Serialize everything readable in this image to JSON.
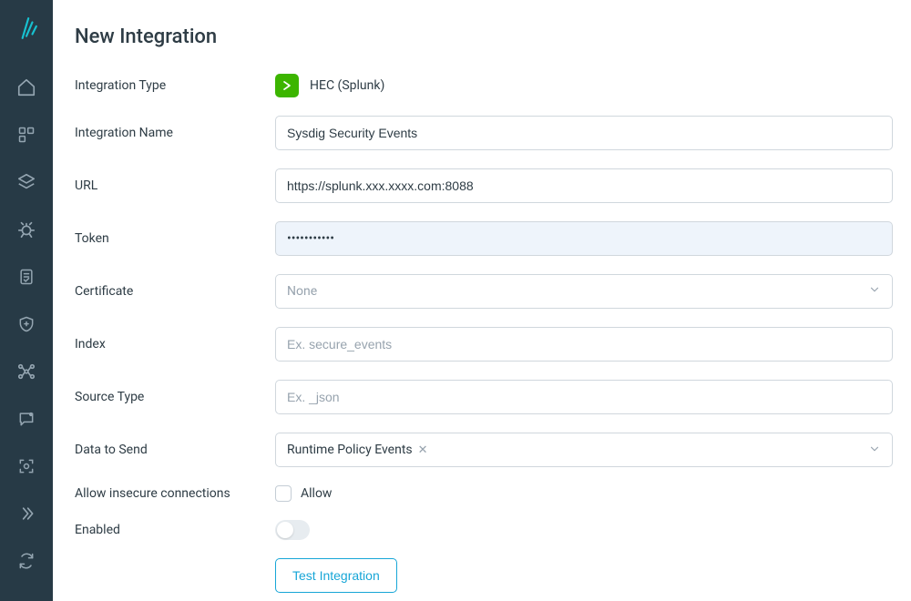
{
  "page": {
    "title": "New Integration"
  },
  "form": {
    "integration_type": {
      "label": "Integration Type",
      "value": "HEC (Splunk)"
    },
    "integration_name": {
      "label": "Integration Name",
      "value": "Sysdig Security Events"
    },
    "url": {
      "label": "URL",
      "value": "https://splunk.xxx.xxxx.com:8088"
    },
    "token": {
      "label": "Token",
      "value": "•••••••••••"
    },
    "certificate": {
      "label": "Certificate",
      "placeholder": "None",
      "value": ""
    },
    "index": {
      "label": "Index",
      "placeholder": "Ex. secure_events",
      "value": ""
    },
    "source_type": {
      "label": "Source Type",
      "placeholder": "Ex. _json",
      "value": ""
    },
    "data_to_send": {
      "label": "Data to Send",
      "selected": [
        "Runtime Policy Events"
      ]
    },
    "allow_insecure": {
      "label": "Allow insecure connections",
      "checkbox_label": "Allow",
      "checked": false
    },
    "enabled": {
      "label": "Enabled",
      "value": false
    },
    "test_button": "Test Integration"
  },
  "sidebar": {
    "icons": [
      "logo",
      "home",
      "apps",
      "layers",
      "bug",
      "report",
      "shield",
      "network",
      "chat",
      "scan",
      "expand",
      "sync"
    ]
  }
}
